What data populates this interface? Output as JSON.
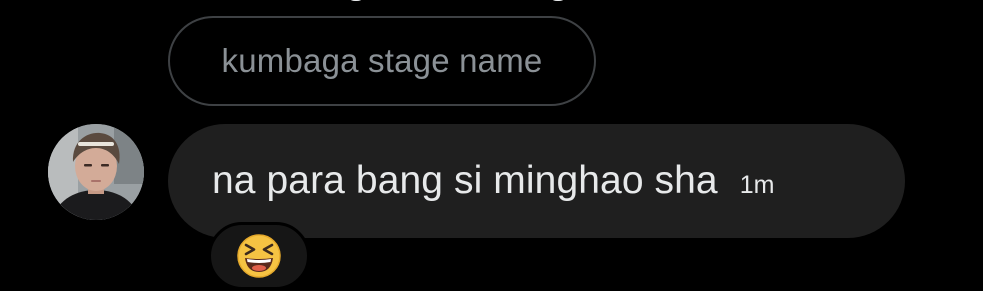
{
  "conversation": {
    "reply_quote": {
      "text": "kumbaga stage name"
    },
    "message": {
      "text": "na para bang si minghao sha",
      "timestamp": "1m",
      "reaction": {
        "emoji_name": "grinning-squinting-face-icon"
      }
    },
    "sender": {
      "avatar_icon": "user-avatar"
    }
  },
  "colors": {
    "background": "#000000",
    "bubble": "#1f1f1f",
    "reply_border": "#3e4144",
    "reply_text": "#8b9196",
    "message_text": "#e7e9ea",
    "reaction_background": "#161616"
  }
}
